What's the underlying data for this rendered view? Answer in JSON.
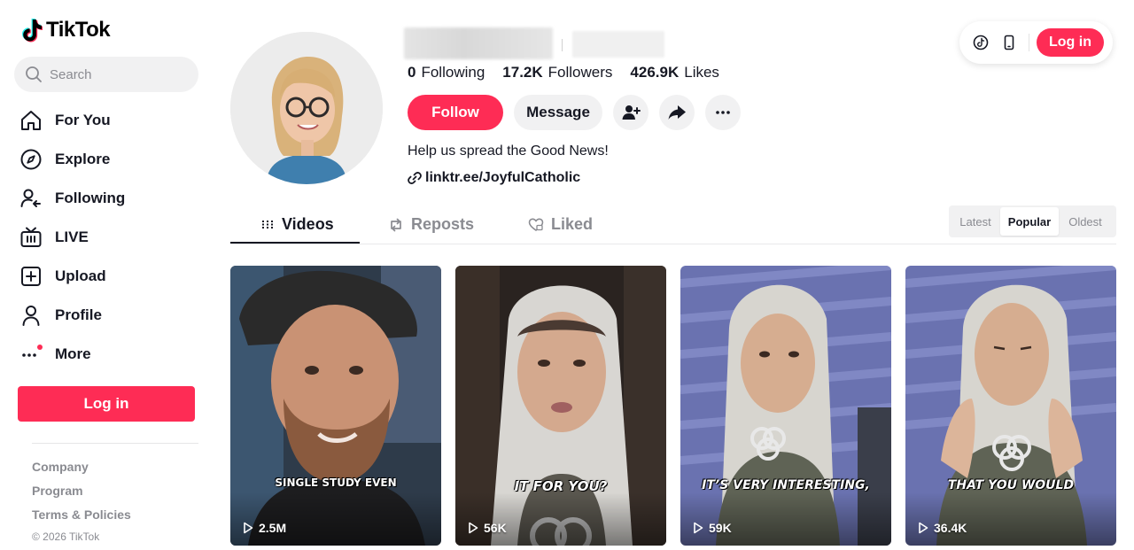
{
  "app": {
    "name": "TikTok"
  },
  "search": {
    "placeholder": "Search"
  },
  "nav": {
    "items": [
      {
        "label": "For You",
        "icon": "home-icon"
      },
      {
        "label": "Explore",
        "icon": "compass-icon"
      },
      {
        "label": "Following",
        "icon": "following-icon"
      },
      {
        "label": "LIVE",
        "icon": "live-icon"
      },
      {
        "label": "Upload",
        "icon": "upload-icon"
      },
      {
        "label": "Profile",
        "icon": "profile-icon"
      },
      {
        "label": "More",
        "icon": "more-icon"
      }
    ],
    "login_label": "Log in"
  },
  "footer": {
    "links": [
      "Company",
      "Program",
      "Terms & Policies"
    ],
    "copyright": "© 2026 TikTok"
  },
  "header": {
    "login_label": "Log in"
  },
  "profile": {
    "stats": [
      {
        "value": "0",
        "label": "Following"
      },
      {
        "value": "17.2K",
        "label": "Followers"
      },
      {
        "value": "426.9K",
        "label": "Likes"
      }
    ],
    "follow_label": "Follow",
    "message_label": "Message",
    "bio": "Help us spread the Good News!",
    "link": "linktr.ee/JoyfulCatholic"
  },
  "tabs": [
    {
      "label": "Videos"
    },
    {
      "label": "Reposts"
    },
    {
      "label": "Liked"
    }
  ],
  "sort": {
    "options": [
      "Latest",
      "Popular",
      "Oldest"
    ],
    "selected": "Popular"
  },
  "videos": [
    {
      "caption": "SINGLE STUDY EVEN",
      "views": "2.5M"
    },
    {
      "caption": "IT FOR YOU?",
      "views": "56K"
    },
    {
      "caption": "IT’S VERY INTERESTING,",
      "views": "59K"
    },
    {
      "caption": "THAT YOU WOULD",
      "views": "36.4K"
    }
  ],
  "colors": {
    "accent": "#fe2c55",
    "text": "#161823",
    "muted": "#8a8b91"
  }
}
